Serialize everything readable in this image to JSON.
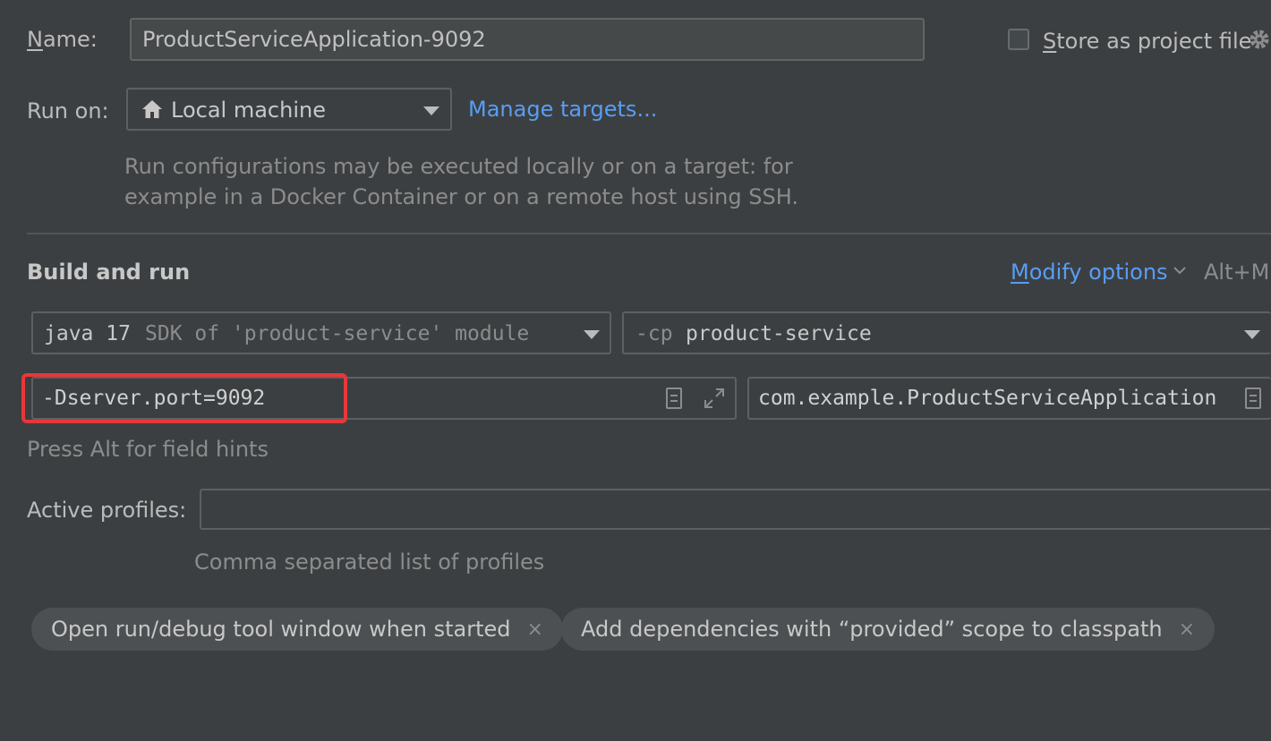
{
  "name": {
    "label_prefix": "",
    "label_underlined": "N",
    "label_rest": "ame:",
    "value": "ProductServiceApplication-9092"
  },
  "store_as_project_file": {
    "label_underlined": "S",
    "label_rest": "tore as project file",
    "checked": false
  },
  "run_on": {
    "label": "Run on:",
    "selected": "Local machine",
    "manage_link": "Manage targets...",
    "description_line1": "Run configurations may be executed locally or on a target: for",
    "description_line2": "example in a Docker Container or on a remote host using SSH."
  },
  "build_and_run": {
    "title": "Build and run",
    "modify_options_underlined": "M",
    "modify_options_rest": "odify options",
    "modify_shortcut": "Alt+M",
    "sdk_main": "java 17",
    "sdk_hint": "SDK of 'product-service' module",
    "cp_prefix": "-cp",
    "cp_value": "product-service",
    "vm_options": "-Dserver.port=9092",
    "main_class": "com.example.ProductServiceApplication",
    "field_hint": "Press Alt for field hints"
  },
  "active_profiles": {
    "label": "Active profiles:",
    "value": "",
    "hint": "Comma separated list of profiles"
  },
  "chips": [
    {
      "label": "Open run/debug tool window when started",
      "remove": "×"
    },
    {
      "label": "Add dependencies with “provided” scope to classpath",
      "remove": "×"
    }
  ],
  "colors": {
    "background": "#3c3f41",
    "link": "#589df6",
    "highlight": "#e8373a"
  },
  "icons": [
    "home-icon",
    "chevron-down-icon",
    "gear-icon",
    "document-icon",
    "expand-icon",
    "close-icon"
  ]
}
